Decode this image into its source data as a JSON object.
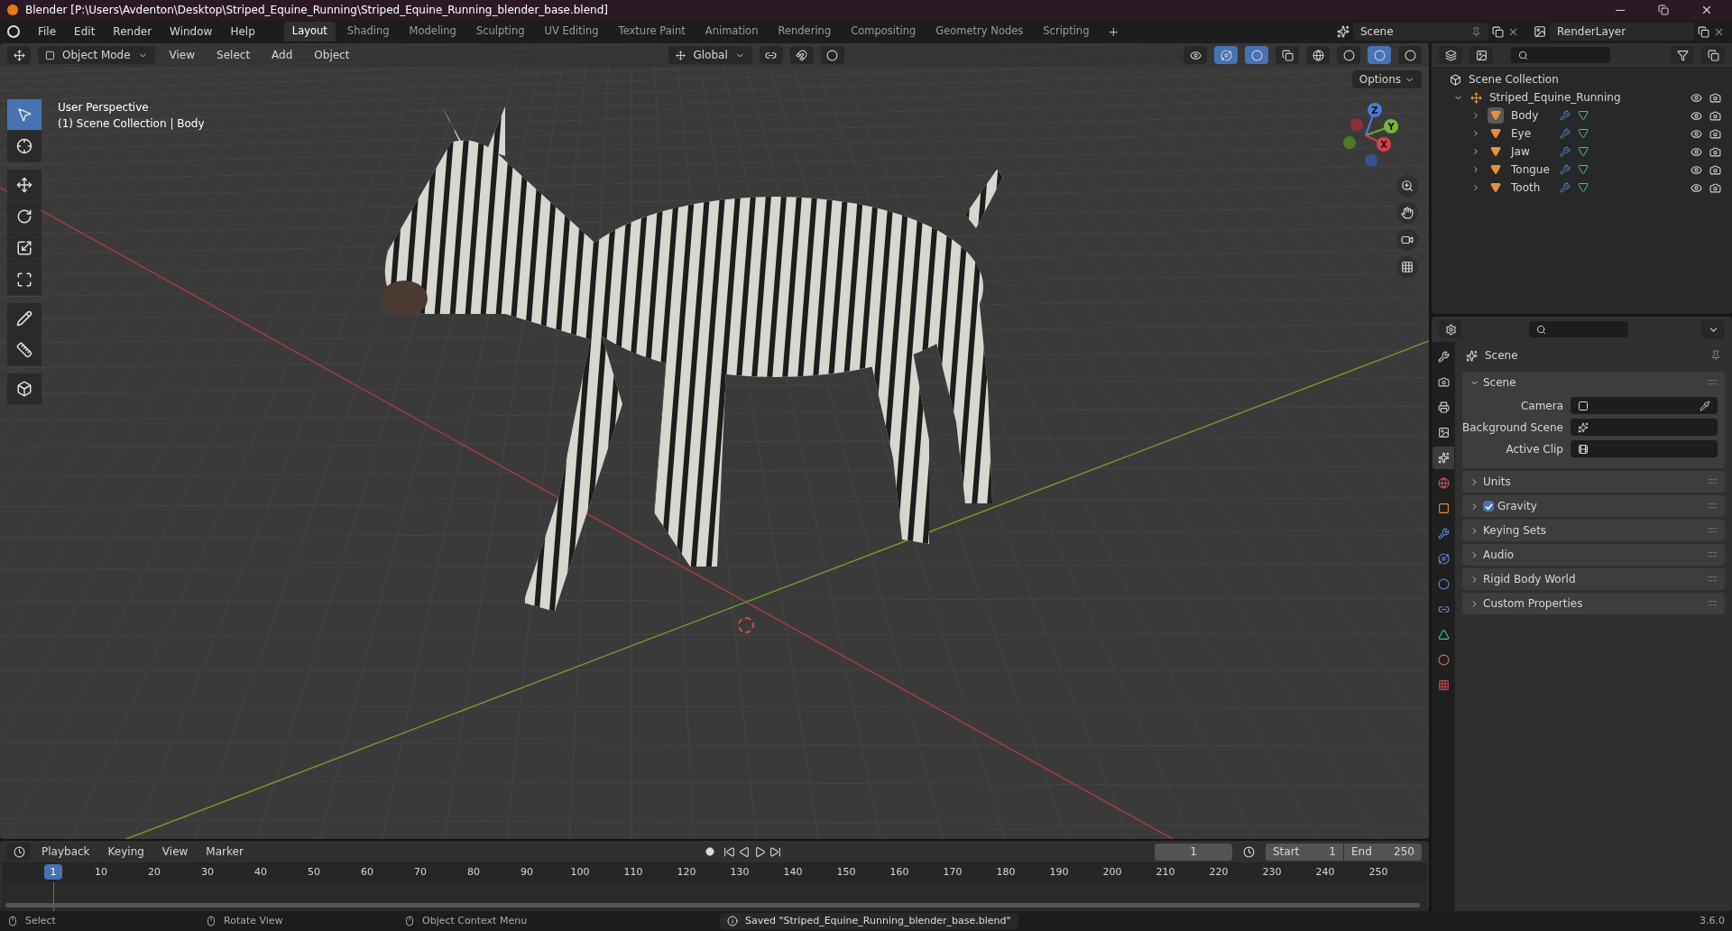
{
  "window": {
    "title": "Blender [P:\\Users\\Avdenton\\Desktop\\Striped_Equine_Running\\Striped_Equine_Running_blender_base.blend]"
  },
  "menu": [
    "File",
    "Edit",
    "Render",
    "Window",
    "Help"
  ],
  "workspaces": [
    {
      "label": "Layout",
      "selected": true
    },
    {
      "label": "Shading",
      "selected": false
    },
    {
      "label": "Modeling",
      "selected": false
    },
    {
      "label": "Sculpting",
      "selected": false
    },
    {
      "label": "UV Editing",
      "selected": false
    },
    {
      "label": "Texture Paint",
      "selected": false
    },
    {
      "label": "Animation",
      "selected": false
    },
    {
      "label": "Rendering",
      "selected": false
    },
    {
      "label": "Compositing",
      "selected": false
    },
    {
      "label": "Geometry Nodes",
      "selected": false
    },
    {
      "label": "Scripting",
      "selected": false
    }
  ],
  "add_workspace": "+",
  "scene_field": "Scene",
  "view_layer_field": "RenderLayer",
  "viewport": {
    "mode": "Object Mode",
    "menus": [
      "View",
      "Select",
      "Add",
      "Object"
    ],
    "orientation": "Global",
    "options": "Options",
    "overlay_text": [
      "User Perspective",
      "(1) Scene Collection | Body"
    ],
    "gizmo_axes": [
      "Z",
      "Y",
      "X"
    ],
    "tool_groups": [
      [
        {
          "kind": "select",
          "selected": true
        },
        {
          "kind": "cursor",
          "selected": false
        }
      ],
      [
        {
          "kind": "move",
          "selected": false
        },
        {
          "kind": "rotate",
          "selected": false
        },
        {
          "kind": "scale",
          "selected": false
        },
        {
          "kind": "transform",
          "selected": false
        }
      ],
      [
        {
          "kind": "annotate",
          "selected": false
        },
        {
          "kind": "measure",
          "selected": false
        }
      ],
      [
        {
          "kind": "add_cube",
          "selected": false
        }
      ]
    ]
  },
  "outliner": {
    "root": "Scene Collection",
    "children": [
      {
        "name": "Striped_Equine_Running",
        "expanded": true,
        "children": [
          {
            "name": "Body",
            "selected": true
          },
          {
            "name": "Eye",
            "selected": false
          },
          {
            "name": "Jaw",
            "selected": false
          },
          {
            "name": "Tongue",
            "selected": false
          },
          {
            "name": "Tooth",
            "selected": false
          }
        ]
      }
    ]
  },
  "properties": {
    "tabs": [
      {
        "kind": "tool",
        "selected": false
      },
      {
        "kind": "render",
        "selected": false
      },
      {
        "kind": "output",
        "selected": false
      },
      {
        "kind": "view_layer",
        "selected": false
      },
      {
        "kind": "scene",
        "selected": true
      },
      {
        "kind": "world",
        "selected": false
      },
      {
        "kind": "object",
        "selected": false
      },
      {
        "kind": "modifier",
        "selected": false
      },
      {
        "kind": "particles",
        "selected": false
      },
      {
        "kind": "physics",
        "selected": false
      },
      {
        "kind": "constraints",
        "selected": false
      },
      {
        "kind": "data",
        "selected": false
      },
      {
        "kind": "material",
        "selected": false
      },
      {
        "kind": "texture",
        "selected": false
      }
    ],
    "context": "Scene",
    "panels": [
      {
        "kind": "plain",
        "title": "Scene",
        "expanded": true,
        "fields": [
          {
            "kind": "camera",
            "label": "Camera"
          },
          {
            "kind": "scene",
            "label": "Background Scene"
          },
          {
            "kind": "clip",
            "label": "Active Clip"
          }
        ]
      },
      {
        "kind": "plain",
        "title": "Units",
        "expanded": false
      },
      {
        "kind": "checkbox",
        "title": "Gravity",
        "expanded": false,
        "checked": true
      },
      {
        "kind": "plain",
        "title": "Keying Sets",
        "expanded": false
      },
      {
        "kind": "plain",
        "title": "Audio",
        "expanded": false
      },
      {
        "kind": "plain",
        "title": "Rigid Body World",
        "expanded": false
      },
      {
        "kind": "plain",
        "title": "Custom Properties",
        "expanded": false
      }
    ]
  },
  "timeline": {
    "menus": [
      "Playback",
      "Keying",
      "View",
      "Marker"
    ],
    "current_frame": "1",
    "start_label": "Start",
    "start": "1",
    "end_label": "End",
    "end": "250",
    "ruler_current": "1",
    "ruler_ticks": [
      "10",
      "20",
      "30",
      "40",
      "50",
      "60",
      "70",
      "80",
      "90",
      "100",
      "110",
      "120",
      "130",
      "140",
      "150",
      "160",
      "170",
      "180",
      "190",
      "200",
      "210",
      "220",
      "230",
      "240",
      "250"
    ]
  },
  "status_bar": {
    "hints": [
      "Select",
      "Rotate View",
      "Object Context Menu"
    ],
    "message": "Saved \"Striped_Equine_Running_blender_base.blend\"",
    "version": "3.6.0"
  }
}
